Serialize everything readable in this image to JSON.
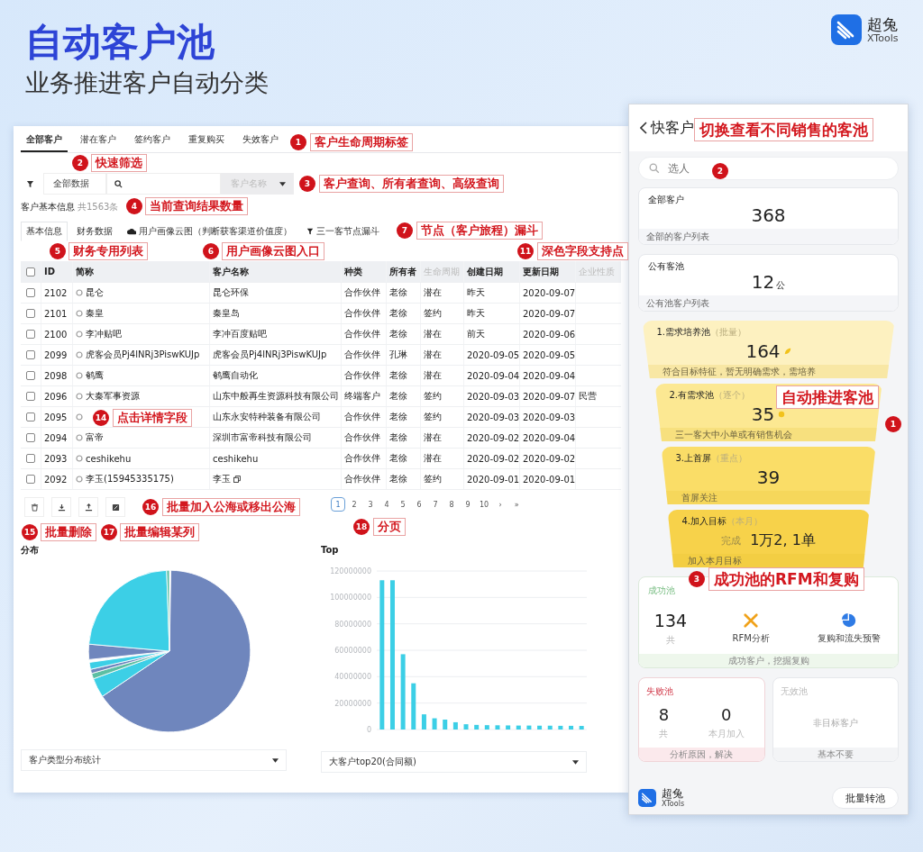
{
  "header": {
    "title": "自动客户池",
    "subtitle": "业务推进客户自动分类"
  },
  "brand": {
    "name": "超兔",
    "sub": "XTools"
  },
  "desktop": {
    "tabs": [
      {
        "label": "全部客户",
        "selected": true
      },
      {
        "label": "潜在客户",
        "selected": false
      },
      {
        "label": "签约客户",
        "selected": false
      },
      {
        "label": "重复购买",
        "selected": false
      },
      {
        "label": "失效客户",
        "selected": false
      }
    ],
    "filter": {
      "scope": "全部数据",
      "search_by": "客户名称"
    },
    "result": {
      "label": "客户基本信息",
      "count": "共1563条"
    },
    "subtabs": [
      {
        "label": "基本信息",
        "kind": "plain",
        "selected": true
      },
      {
        "label": "财务数据",
        "kind": "plain",
        "selected": false
      },
      {
        "label": "用户画像云图（判断获客渠道价值度）",
        "kind": "cloud",
        "selected": false
      },
      {
        "label": "三一客节点漏斗",
        "kind": "funnel",
        "selected": false
      }
    ],
    "table": {
      "all_checked": false,
      "columns": [
        {
          "label": "ID",
          "muted": false
        },
        {
          "label": "简称",
          "muted": false
        },
        {
          "label": "客户名称",
          "muted": false
        },
        {
          "label": "种类",
          "muted": false
        },
        {
          "label": "所有者",
          "muted": false
        },
        {
          "label": "生命周期",
          "muted": true
        },
        {
          "label": "创建日期",
          "muted": false
        },
        {
          "label": "更新日期",
          "muted": false
        },
        {
          "label": "企业性质",
          "muted": true
        }
      ],
      "rows": [
        {
          "checked": false,
          "id": "2102",
          "short_name": "昆仑",
          "name": "昆仑环保",
          "type": "合作伙伴",
          "owner": "老徐",
          "stage": "潜在",
          "created": "昨天",
          "updated": "2020-09-07"
        },
        {
          "checked": false,
          "id": "2101",
          "short_name": "秦皇",
          "name": "秦皇岛",
          "type": "合作伙伴",
          "owner": "老徐",
          "stage": "签约",
          "created": "昨天",
          "updated": "2020-09-07"
        },
        {
          "checked": false,
          "id": "2100",
          "short_name": "李冲贴吧",
          "name": "李冲百度贴吧",
          "type": "合作伙伴",
          "owner": "老徐",
          "stage": "潜在",
          "created": "前天",
          "updated": "2020-09-06"
        },
        {
          "checked": false,
          "id": "2099",
          "short_name": "虎客会员Pj4lNRj3PiswKUJp",
          "name": "虎客会员Pj4lNRj3PiswKUJp",
          "type": "合作伙伴",
          "owner": "孔琳",
          "stage": "潜在",
          "created": "2020-09-05",
          "updated": "2020-09-05"
        },
        {
          "checked": false,
          "id": "2098",
          "short_name": "鹌鹰",
          "name": "鹌鹰自动化",
          "type": "合作伙伴",
          "owner": "老徐",
          "stage": "潜在",
          "created": "2020-09-04",
          "updated": "2020-09-04"
        },
        {
          "checked": false,
          "id": "2096",
          "short_name": "大秦军事资源",
          "name": "山东中般再生资源科技有限公司",
          "type": "终端客户",
          "owner": "老徐",
          "stage": "签约",
          "created": "2020-09-03",
          "updated": "2020-09-07",
          "nature": "民营"
        },
        {
          "checked": false,
          "id": "2095",
          "name": "山东永安特种装备有限公司",
          "type": "合作伙伴",
          "owner": "老徐",
          "stage": "签约",
          "created": "2020-09-03",
          "updated": "2020-09-03"
        },
        {
          "checked": false,
          "id": "2094",
          "short_name": "富帝",
          "name": "深圳市富帝科技有限公司",
          "type": "合作伙伴",
          "owner": "老徐",
          "stage": "潜在",
          "created": "2020-09-02",
          "updated": "2020-09-04"
        },
        {
          "checked": false,
          "id": "2093",
          "short_name": "ceshikehu",
          "name": "ceshikehu",
          "type": "合作伙伴",
          "owner": "老徐",
          "stage": "潜在",
          "created": "2020-09-02",
          "updated": "2020-09-02"
        },
        {
          "checked": false,
          "id": "2092",
          "short_name": "李玉(15945335175)",
          "name": "李玉",
          "type": "合作伙伴",
          "owner": "老徐",
          "stage": "签约",
          "created": "2020-09-01",
          "updated": "2020-09-01",
          "note_icon": true
        }
      ]
    },
    "pages": [
      {
        "label": "1",
        "selected": true
      },
      {
        "label": "2",
        "selected": false
      },
      {
        "label": "3",
        "selected": false
      },
      {
        "label": "4",
        "selected": false
      },
      {
        "label": "5",
        "selected": false
      },
      {
        "label": "6",
        "selected": false
      },
      {
        "label": "7",
        "selected": false
      },
      {
        "label": "8",
        "selected": false
      },
      {
        "label": "9",
        "selected": false
      },
      {
        "label": "10",
        "selected": false
      },
      {
        "label": "›",
        "selected": false
      },
      {
        "label": "»",
        "selected": false
      }
    ],
    "pie": {
      "title": "分布",
      "selector": "客户类型分布统计"
    },
    "bar": {
      "title": "Top",
      "selector": "大客户top20(合同额)",
      "chart_data": {
        "type": "bar",
        "grid": true,
        "ylim": [
          0,
          120000000
        ],
        "yticks": [
          0,
          20000000,
          40000000,
          60000000,
          80000000,
          100000000,
          120000000
        ],
        "values": [
          113000000,
          113000000,
          57000000,
          35000000,
          11500000,
          8500000,
          7500000,
          5500000,
          4000000,
          3500000,
          3300000,
          3200000,
          3100000,
          3000000,
          3000000,
          2900000,
          2900000,
          2800000,
          2800000,
          2700000
        ]
      }
    }
  },
  "mobile": {
    "title": "快客户",
    "search_placeholder": "选人",
    "cards": [
      {
        "name": "全部客户",
        "count": "368",
        "footer": "全部的客户列表"
      },
      {
        "name": "公有客池",
        "count": "12",
        "unit": "公",
        "footer": "公有池客户列表"
      }
    ],
    "funnel": [
      {
        "name": "1.需求培养池",
        "hint": "（批量）",
        "count": "164",
        "kind": "leaf",
        "footer": "符合目标特征，暂无明确需求，需培养"
      },
      {
        "name": "2.有需求池",
        "hint": "（逐个）",
        "count": "35",
        "kind": "dot",
        "footer": "三一客大中小单或有销售机会"
      },
      {
        "name": "3.上首屏",
        "hint": "（重点）",
        "count": "39",
        "kind": "plain",
        "footer": "首屏关注"
      },
      {
        "name": "4.加入目标",
        "hint": "（本月）",
        "prefix": "完成",
        "count": "1万2, 1单",
        "kind": "plain",
        "footer": "加入本月目标"
      }
    ],
    "success": {
      "name": "成功池",
      "count": "134",
      "count_label": "共",
      "tools": [
        {
          "label": "RFM分析",
          "kind": "rfm"
        },
        {
          "label": "复购和流失预警",
          "kind": "pie"
        }
      ],
      "footer": "成功客户，挖掘复购"
    },
    "failed": {
      "name": "失败池",
      "stats": [
        {
          "value": "8",
          "label": "共"
        },
        {
          "value": "0",
          "label": "本月加入"
        }
      ],
      "footer": "分析原因，解决"
    },
    "invalid": {
      "name": "无效池",
      "note": "非目标客户",
      "footer": "基本不要"
    },
    "brand": {
      "name": "超兔",
      "sub": "XTools"
    },
    "button": "批量转池"
  },
  "annotations": [
    {
      "number": "1",
      "text": "客户生命周期标签"
    },
    {
      "number": "2",
      "text": "快速筛选"
    },
    {
      "number": "3",
      "text": "客户查询、所有者查询、高级查询"
    },
    {
      "number": "4",
      "text": "当前查询结果数量"
    },
    {
      "number": "7",
      "text": "节点（客户旅程）漏斗"
    },
    {
      "number": "5",
      "text": "财务专用列表"
    },
    {
      "number": "6",
      "text": "用户画像云图入口"
    },
    {
      "number": "11",
      "text": "深色字段支持点"
    },
    {
      "number": "14",
      "text": "点击详情字段"
    },
    {
      "number": "16",
      "text": "批量加入公海或移出公海"
    },
    {
      "number": "15",
      "text": "批量删除"
    },
    {
      "number": "17",
      "text": "批量编辑某列"
    },
    {
      "number": "18",
      "text": "分页"
    },
    {
      "number": "2",
      "text": "切换查看不同销售的客池"
    },
    {
      "number": "1",
      "text": "自动推进客池"
    },
    {
      "number": "3",
      "text": "成功池的RFM和复购"
    }
  ]
}
